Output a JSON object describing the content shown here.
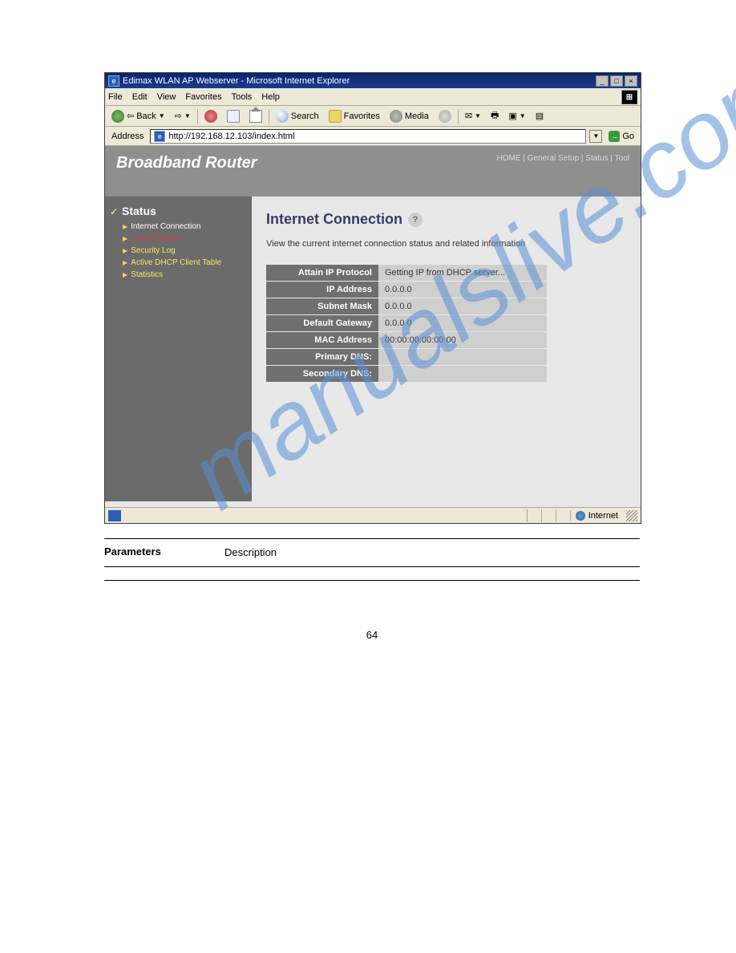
{
  "watermark": "manualslive.com",
  "browser": {
    "title": "Edimax WLAN AP Webserver - Microsoft Internet Explorer",
    "menu": [
      "File",
      "Edit",
      "View",
      "Favorites",
      "Tools",
      "Help"
    ],
    "toolbar": {
      "back": "Back",
      "search": "Search",
      "favorites": "Favorites",
      "media": "Media"
    },
    "addressLabel": "Address",
    "addressValue": "http://192.168.12.103/index.html",
    "go": "Go"
  },
  "router": {
    "brand": "Broadband Router",
    "nav": [
      "HOME",
      "General Setup",
      "Status",
      "Tool"
    ],
    "sidebarTitle": "Status",
    "sidebarItems": [
      {
        "label": "Internet Connection",
        "cls": "active-white"
      },
      {
        "label": "Device Status",
        "cls": "active-red"
      },
      {
        "label": "Security Log",
        "cls": ""
      },
      {
        "label": "Active DHCP Client Table",
        "cls": ""
      },
      {
        "label": "Statistics",
        "cls": ""
      }
    ],
    "panelTitle": "Internet Connection",
    "panelDesc": "View the current internet connection status and related information",
    "table": [
      {
        "label": "Attain IP Protocol",
        "value": "Getting IP from DHCP server..."
      },
      {
        "label": "IP Address",
        "value": "0.0.0.0"
      },
      {
        "label": "Subnet Mask",
        "value": "0.0.0.0"
      },
      {
        "label": "Default Gateway",
        "value": "0.0.0.0"
      },
      {
        "label": "MAC Address",
        "value": "00:00:00:00:00:00"
      },
      {
        "label": "Primary DNS:",
        "value": ""
      },
      {
        "label": "Secondary DNS:",
        "value": ""
      }
    ]
  },
  "statusbar": {
    "zone": "Internet"
  },
  "doc": {
    "paramsHeader": {
      "p": "Parameters",
      "d": "Description"
    },
    "params": [
      {
        "p": "",
        "d": ""
      }
    ],
    "pageNum": "64"
  }
}
